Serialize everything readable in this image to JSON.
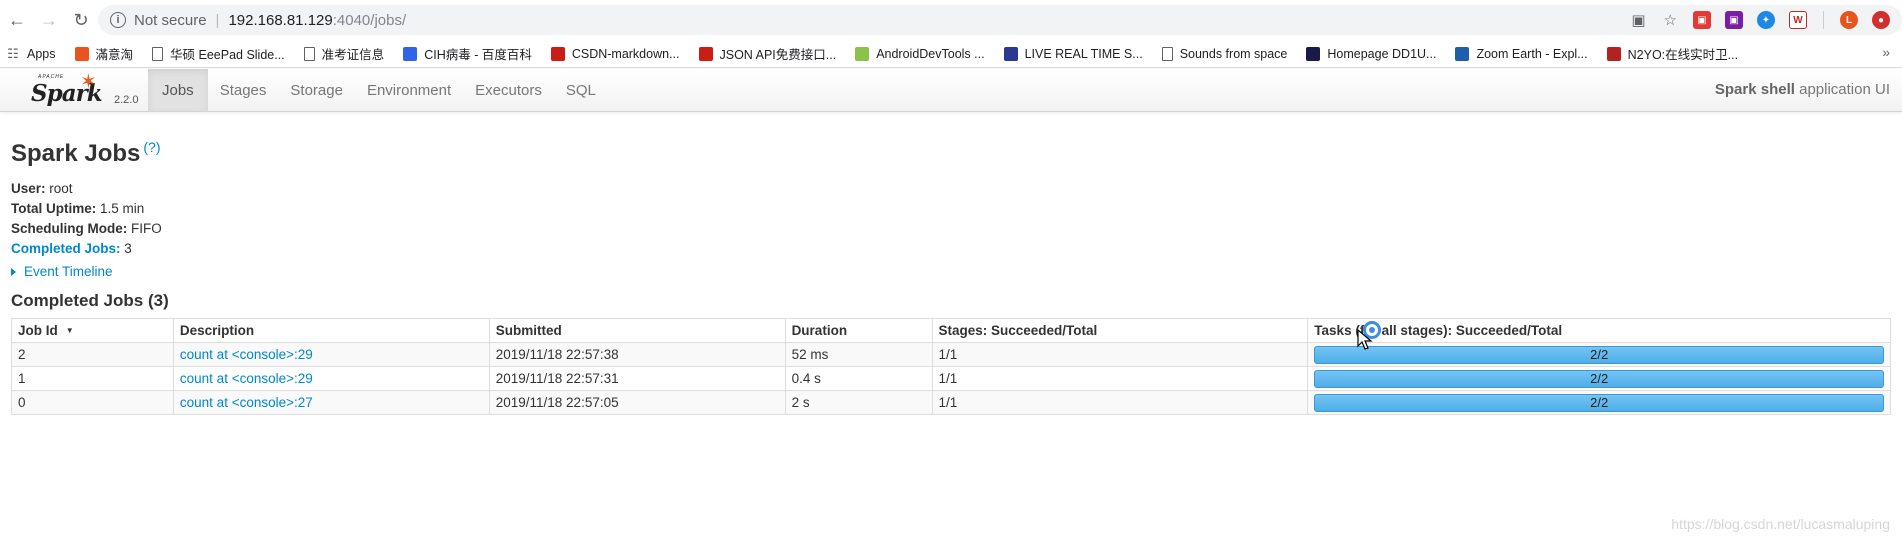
{
  "browser": {
    "security_label": "Not secure",
    "url_host": "192.168.81.129",
    "url_path": ":4040/jobs/",
    "bookmarks": [
      {
        "label": "Apps",
        "color": "#5f6368"
      },
      {
        "label": "滿意淘",
        "color": "#e8541c"
      },
      {
        "label": "华硕 EeePad Slide...",
        "color": "file"
      },
      {
        "label": "准考证信息",
        "color": "file"
      },
      {
        "label": "CIH病毒 - 百度百科",
        "color": "#3064e8"
      },
      {
        "label": "CSDN-markdown...",
        "color": "#c91d16"
      },
      {
        "label": "JSON API免费接口...",
        "color": "#c91d16"
      },
      {
        "label": "AndroidDevTools ...",
        "color": "#8bc34a"
      },
      {
        "label": "LIVE REAL TIME S...",
        "color": "#2b3990"
      },
      {
        "label": "Sounds from space",
        "color": "file"
      },
      {
        "label": "Homepage DD1U...",
        "color": "#1a1a4a"
      },
      {
        "label": "Zoom Earth - Expl...",
        "color": "#1d5fa8"
      },
      {
        "label": "N2YO:在线实时卫...",
        "color": "#b22222"
      }
    ]
  },
  "spark": {
    "brand": "Spark",
    "apache": "APACHE",
    "version": "2.2.0",
    "tabs": [
      "Jobs",
      "Stages",
      "Storage",
      "Environment",
      "Executors",
      "SQL"
    ],
    "app_name": "Spark shell",
    "app_suffix": " application UI"
  },
  "page": {
    "title": "Spark Jobs",
    "help": "(?)",
    "user_label": "User:",
    "user_value": " root",
    "uptime_label": "Total Uptime:",
    "uptime_value": " 1.5 min",
    "mode_label": "Scheduling Mode:",
    "mode_value": " FIFO",
    "completed_label": "Completed Jobs:",
    "completed_value": " 3",
    "event_timeline": "Event Timeline",
    "section_title": "Completed Jobs (3)"
  },
  "table": {
    "headers": [
      "Job Id",
      "Description",
      "Submitted",
      "Duration",
      "Stages: Succeeded/Total",
      "Tasks (for all stages): Succeeded/Total"
    ],
    "rows": [
      {
        "id": "2",
        "desc": "count at <console>:29",
        "submitted": "2019/11/18 22:57:38",
        "duration": "52 ms",
        "stages": "1/1",
        "tasks": "2/2",
        "tasks_fraction": 1.0
      },
      {
        "id": "1",
        "desc": "count at <console>:29",
        "submitted": "2019/11/18 22:57:31",
        "duration": "0.4 s",
        "stages": "1/1",
        "tasks": "2/2",
        "tasks_fraction": 1.0
      },
      {
        "id": "0",
        "desc": "count at <console>:27",
        "submitted": "2019/11/18 22:57:05",
        "duration": "2 s",
        "stages": "1/1",
        "tasks": "2/2",
        "tasks_fraction": 1.0
      }
    ]
  },
  "watermark": "https://blog.csdn.net/lucasmaluping"
}
